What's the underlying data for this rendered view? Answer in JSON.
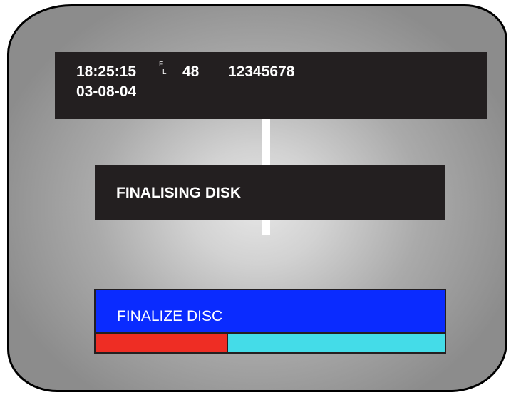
{
  "osd": {
    "time": "18:25:15",
    "f_indicator": "F",
    "l_indicator": "L",
    "channel": "48",
    "serial": "12345678",
    "date": "03-08-04"
  },
  "status": {
    "message": "FINALISING DISK"
  },
  "finalize": {
    "label": "FINALIZE DISC",
    "progress_fraction": 0.38
  },
  "colors": {
    "osd_background": "#231f20",
    "finalize_bar": "#0a2bff",
    "progress_done": "#ee2d24",
    "progress_remaining": "#44dce8"
  }
}
